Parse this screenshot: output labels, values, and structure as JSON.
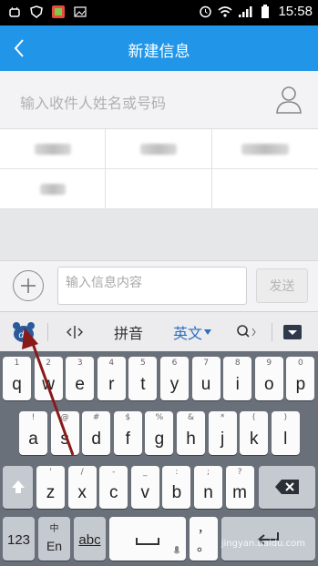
{
  "status_bar": {
    "time": "15:58",
    "icons": [
      "android-icon",
      "vpn-shield-icon",
      "app-icon",
      "image-icon",
      "alarm-icon",
      "wifi-icon",
      "signal-icon",
      "battery-icon"
    ]
  },
  "header": {
    "title": "新建信息",
    "back_icon": "chevron-left-icon",
    "background": "#2196e8"
  },
  "recipient": {
    "placeholder": "输入收件人姓名或号码",
    "contact_icon": "person-icon"
  },
  "suggestions": {
    "note": "",
    "cells": [
      "",
      "",
      "",
      "",
      "",
      ""
    ]
  },
  "compose": {
    "placeholder": "输入信息内容",
    "send_label": "发送",
    "plus_icon": "plus-circle-icon"
  },
  "keyboard_toolbar": {
    "logo": "du",
    "cursor_icon": "cursor-move-icon",
    "pinyin": "拼音",
    "english": "英文",
    "search_icon": "search-icon",
    "hide_icon": "keyboard-hide-icon"
  },
  "keyboard": {
    "row1": [
      {
        "main": "q",
        "sub": "1"
      },
      {
        "main": "w",
        "sub": "2"
      },
      {
        "main": "e",
        "sub": "3"
      },
      {
        "main": "r",
        "sub": "4"
      },
      {
        "main": "t",
        "sub": "5"
      },
      {
        "main": "y",
        "sub": "6"
      },
      {
        "main": "u",
        "sub": "7"
      },
      {
        "main": "i",
        "sub": "8"
      },
      {
        "main": "o",
        "sub": "9"
      },
      {
        "main": "p",
        "sub": "0"
      }
    ],
    "row2": [
      {
        "main": "a",
        "sub": "!"
      },
      {
        "main": "s",
        "sub": "@"
      },
      {
        "main": "d",
        "sub": "#"
      },
      {
        "main": "f",
        "sub": "$"
      },
      {
        "main": "g",
        "sub": "%"
      },
      {
        "main": "h",
        "sub": "&"
      },
      {
        "main": "j",
        "sub": "*"
      },
      {
        "main": "k",
        "sub": "("
      },
      {
        "main": "l",
        "sub": ")"
      }
    ],
    "row3": [
      {
        "main": "z",
        "sub": "'"
      },
      {
        "main": "x",
        "sub": "/"
      },
      {
        "main": "c",
        "sub": "-"
      },
      {
        "main": "v",
        "sub": "_"
      },
      {
        "main": "b",
        "sub": ":"
      },
      {
        "main": "n",
        "sub": ";"
      },
      {
        "main": "m",
        "sub": "?"
      }
    ],
    "num_label": "123",
    "lang_top": "中",
    "lang_bottom": "En",
    "abc_label": "abc",
    "punct_top": "，",
    "punct_bottom": "。",
    "shift_icon": "shift-up-icon",
    "delete_icon": "backspace-icon",
    "space_icon": "space-icon",
    "mic_icon": "mic-icon",
    "enter_icon": "enter-icon"
  },
  "watermark": "jingyan.baidu.com"
}
